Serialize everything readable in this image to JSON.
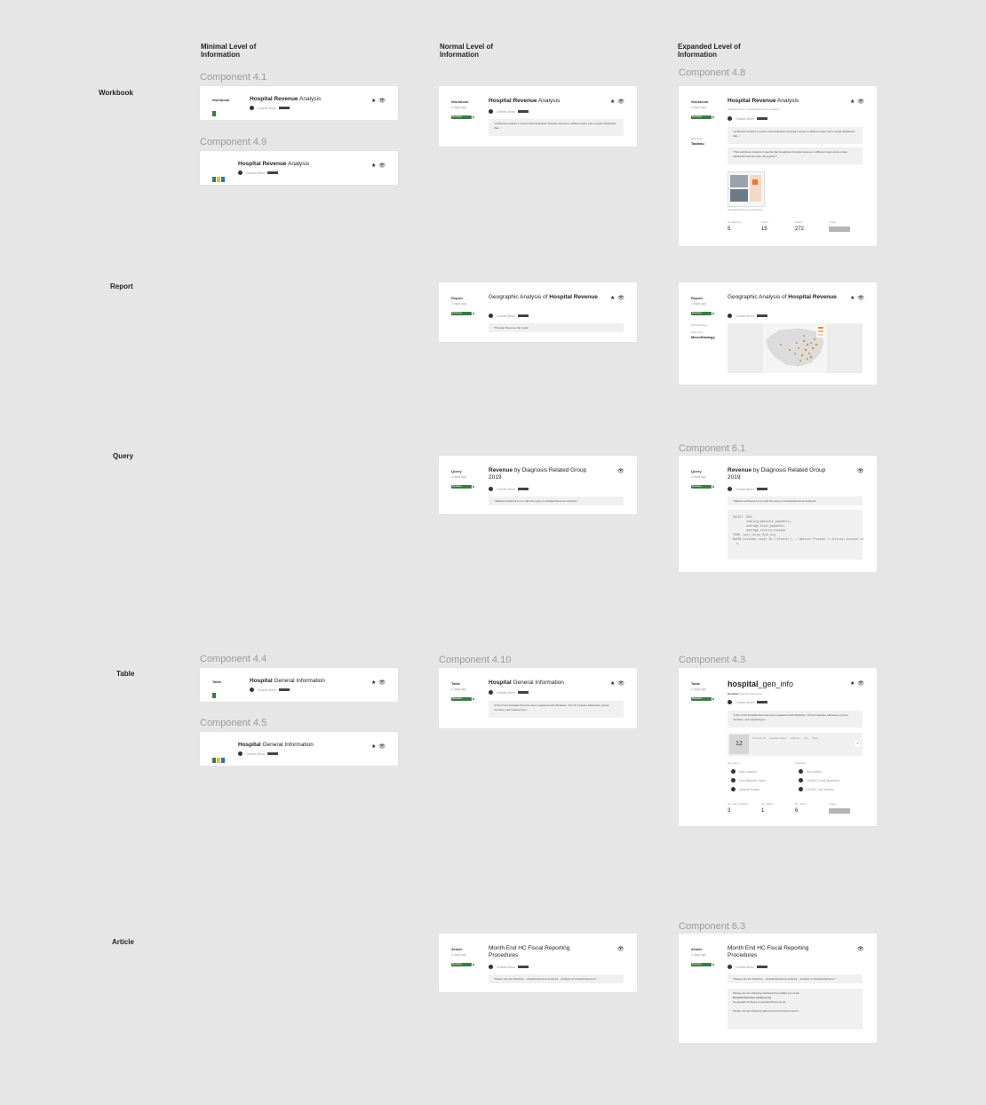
{
  "columns": {
    "minimal": "Minimal Level of Information",
    "normal": "Normal Level of Information",
    "expanded": "Expanded Level of Information"
  },
  "rows": {
    "workbook": "Workbook",
    "report": "Report",
    "query": "Query",
    "table": "Table",
    "article": "Article"
  },
  "components": {
    "c41": "Component 4.1",
    "c49": "Component 4.9",
    "c48": "Component 4.8",
    "c44": "Component 4.4",
    "c45": "Component 4.5",
    "c410": "Component 4.10",
    "c43": "Component 4.3",
    "c61": "Component 6.1",
    "c63": "Component 6.3"
  },
  "common": {
    "owner": "Charles Brien",
    "badge": "Endorsed",
    "star": "★",
    "eye": "👁"
  },
  "workbook": {
    "type": "Workbook",
    "ago": "2 days ago",
    "title_bold": "Hospital Revenue",
    "title_rest": " Analysis",
    "quote1": "\"workbook contains 4 reports that breakdown hospital revenue in different ways and a single dashboard that...\"",
    "quote2": "\"This workbook contains 4 reports that breakdown hospital revenue in different ways and a single dashboard that ties them all together\"",
    "breadcrumb_a": "Tableau Online",
    "breadcrumb_b": "Hospital Revenue Analysis",
    "datafrom_label": "Data from",
    "datafrom": "Tableau",
    "thumb_caption": "Hospital Revenue Calculation",
    "stats": [
      {
        "label": "No Reports",
        "value": "5"
      },
      {
        "label": "Users",
        "value": "15"
      },
      {
        "label": "Views",
        "value": "272"
      },
      {
        "label": "Usage",
        "value": ""
      }
    ]
  },
  "report": {
    "type": "Report",
    "ago": "2 days ago",
    "title_rest": "Geographic Analysis of ",
    "title_bold": "Hospital Revenue",
    "quote": "\"Provider Revenue Zip Code\"",
    "source": "MicroStrategy",
    "datafrom_label": "Data from",
    "datafrom": "MicroStrategy"
  },
  "query": {
    "type": "Query",
    "ago": "4 days ago",
    "title_bold": "Revenue",
    "title_rest": " by Diagnosis Related Group 2019",
    "quote": "\"Tableau workbook to run with this query is Hospital Revenue Analysis\"",
    "sql": "SELECT  DRG,\n        sum(avg_medicare_payments),\n        average_total_payments,\n        average_covered_charges\nFROM  inpt_chrgs_fy15_drg\nWHERE provider_state IN ('Alterdt') -- Medical Provider's official Account in\n  1;"
  },
  "table": {
    "type": "Table",
    "ago": "2 days ago",
    "title_bold": "Hospital",
    "title_rest": " General Information",
    "big_title_bold": "hospital",
    "big_title_rest": "_gen_info",
    "subtitle_bold": "Hospital",
    "subtitle_rest": " General Information",
    "quote": "\"A list of all Hospitals that have been registered with Medicare. The list includes addresses, phone numbers, and hospital type.\"",
    "preview_num": "12",
    "preview_cols": [
      "Provider ID",
      "Hospital Name",
      "Address",
      "City",
      "State",
      "Zip Code"
    ],
    "top_users_label": "Top Users",
    "top_users": [
      "Dan Lambert",
      "Femi Barnett-Yalpe",
      "Hannah Brown"
    ],
    "stewards_label": "Stewards",
    "stewards": [
      "Eric Amtes",
      "ClOWC Local Members",
      "ClOWC Jeff Admins"
    ],
    "stats": [
      {
        "label": "No. Pub. Queries",
        "value": "3"
      },
      {
        "label": "No. Filters",
        "value": "1"
      },
      {
        "label": "No. Joins",
        "value": "6"
      },
      {
        "label": "Usage",
        "value": ""
      }
    ]
  },
  "article": {
    "type": "Article",
    "ago": "4 days ago",
    "title": "Month End HC Fiscal Reporting Procedures",
    "quote": "\"Please use the following... Hospital Revenue Analysis... Analysis of Hospital Revenue\"",
    "body": [
      "Please use the following dashboard to publish your data:",
      "Hospital Revenue Analysis [1]",
      "Geographic Analysis of Hospital Revenue [2]",
      "",
      "Please use the following data sources for Fiscal reports:"
    ]
  }
}
